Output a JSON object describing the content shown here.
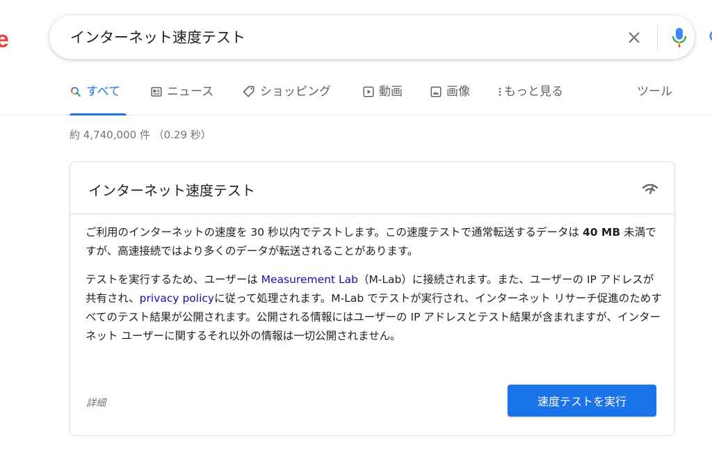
{
  "logo_fragment": "e",
  "search": {
    "query": "インターネット速度テスト"
  },
  "tabs": [
    {
      "label": "すべて",
      "icon": "search-icon"
    },
    {
      "label": "ニュース",
      "icon": "newspaper-icon"
    },
    {
      "label": "ショッピング",
      "icon": "tag-icon"
    },
    {
      "label": "動画",
      "icon": "play-icon"
    },
    {
      "label": "画像",
      "icon": "image-icon"
    },
    {
      "label": "もっと見る",
      "icon": "more-vert-icon"
    }
  ],
  "tools_label": "ツール",
  "result_stats": "約 4,740,000 件 （0.29 秒）",
  "card": {
    "title": "インターネット速度テスト",
    "para1_a": "ご利用のインターネットの速度を 30 秒以内でテストします。この速度テストで通常転送するデータは ",
    "para1_bold": "40 MB",
    "para1_b": " 未満ですが、高速接続ではより多くのデータが転送されることがあります。",
    "para2_a": "テストを実行するため、ユーザーは ",
    "link_mlab": "Measurement Lab",
    "para2_b": "（M-Lab）に接続されます。また、ユーザーの IP アドレスが共有され、",
    "link_privacy": "privacy policy",
    "para2_c": "に従って処理されます。M-Lab でテストが実行され、インターネット リサーチ促進のためすべてのテスト結果が公開されます。公開される情報にはユーザーの IP アドレスとテスト結果が含まれますが、インターネット ユーザーに関するそれ以外の情報は一切公開されません。",
    "details_label": "詳細",
    "run_button_label": "速度テストを実行"
  },
  "colors": {
    "accent": "#1a73e8",
    "link": "#1a0dab",
    "mic_red": "#ea4335"
  }
}
